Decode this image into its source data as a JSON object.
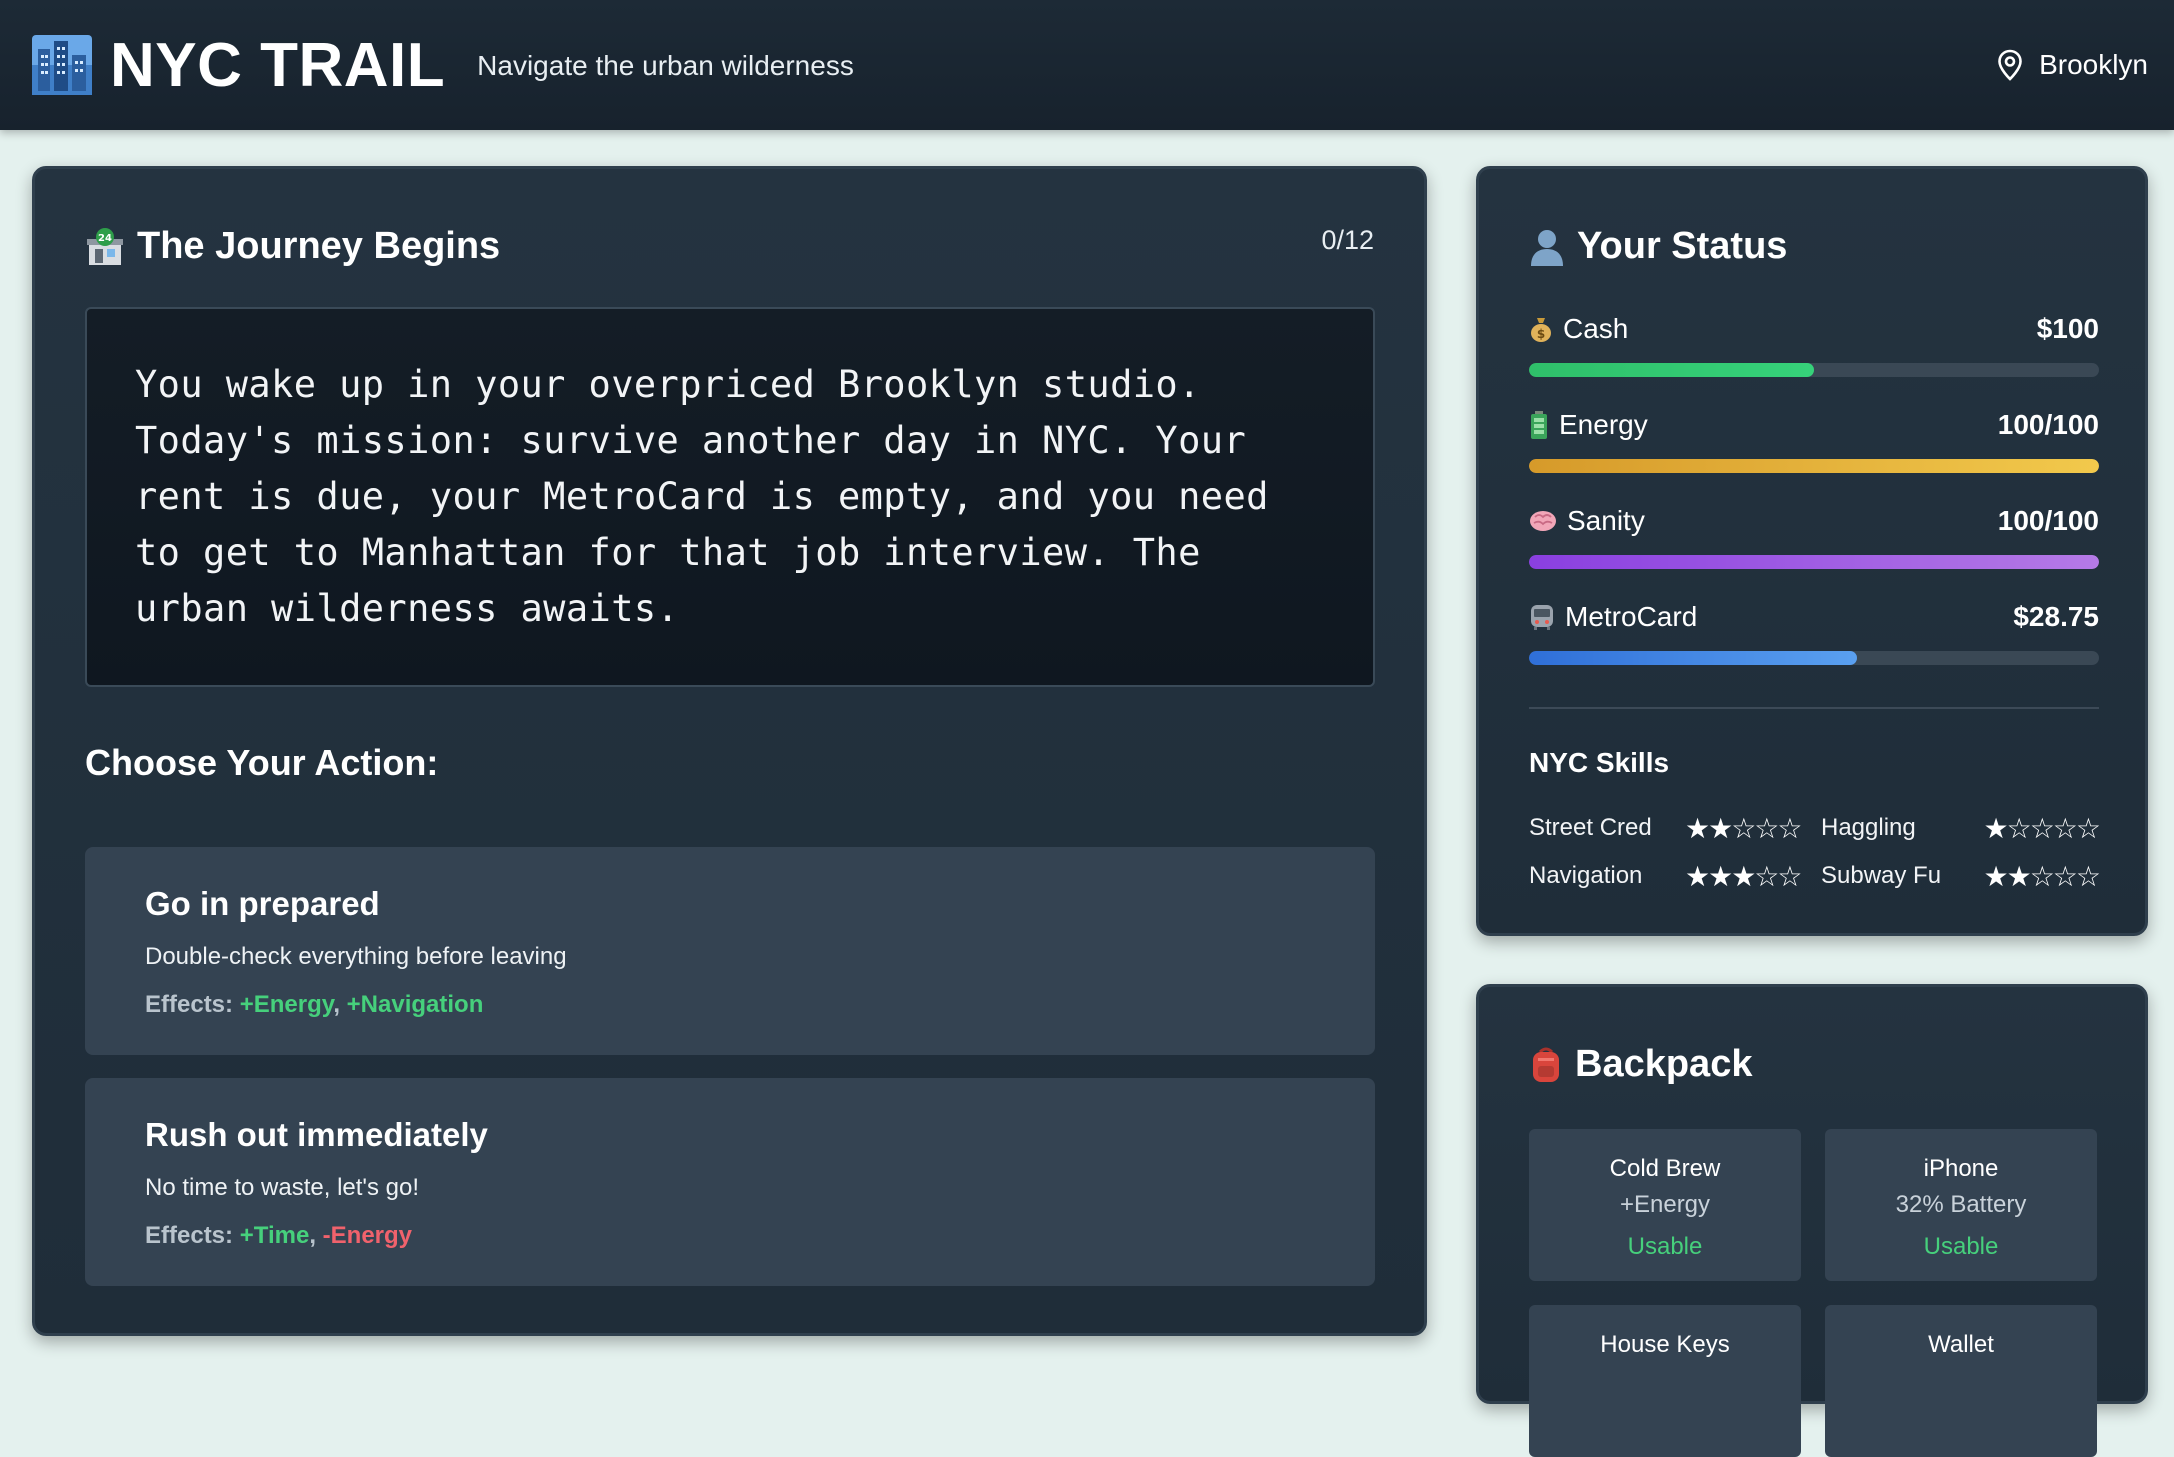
{
  "app": {
    "title": "NYC TRAIL",
    "tagline": "Navigate the urban wilderness",
    "location": "Brooklyn",
    "logo_icon": "cityscape-icon",
    "location_icon": "map-pin-icon"
  },
  "journey": {
    "title": "The Journey Begins",
    "icon": "atm-sign-icon",
    "progress": "0/12",
    "story": "You wake up in your overpriced Brooklyn studio. Today's mission: survive another day in NYC. Your rent is due, your MetroCard is empty, and you need to get to Manhattan for that job interview. The urban wilderness awaits.",
    "choose_label": "Choose Your Action:",
    "choices": [
      {
        "title": "Go in prepared",
        "description": "Double-check everything before leaving",
        "effects_label": "Effects:",
        "effects": [
          {
            "text": "+Energy",
            "type": "positive"
          },
          {
            "text": "+Navigation",
            "type": "positive"
          }
        ]
      },
      {
        "title": "Rush out immediately",
        "description": "No time to waste, let's go!",
        "effects_label": "Effects:",
        "effects": [
          {
            "text": "+Time",
            "type": "positive"
          },
          {
            "text": "-Energy",
            "type": "negative"
          }
        ]
      }
    ]
  },
  "status": {
    "title": "Your Status",
    "icon": "person-silhouette-icon",
    "stats": [
      {
        "name": "Cash",
        "icon": "money-bag-icon",
        "value": "$100",
        "fill": 0.5,
        "color_from": "#2fbf6a",
        "color_to": "#36d27a"
      },
      {
        "name": "Energy",
        "icon": "battery-icon",
        "value": "100/100",
        "fill": 1.0,
        "color_from": "#d69a2a",
        "color_to": "#f2c94c"
      },
      {
        "name": "Sanity",
        "icon": "brain-icon",
        "value": "100/100",
        "fill": 1.0,
        "color_from": "#8a3fe0",
        "color_to": "#b57ae6"
      },
      {
        "name": "MetroCard",
        "icon": "metro-train-icon",
        "value": "$28.75",
        "fill": 0.575,
        "color_from": "#2f6fd8",
        "color_to": "#5aa0f0"
      }
    ],
    "skills_title": "NYC Skills",
    "skills": [
      {
        "name": "Street Cred",
        "rating": 2
      },
      {
        "name": "Haggling",
        "rating": 1
      },
      {
        "name": "Navigation",
        "rating": 3
      },
      {
        "name": "Subway Fu",
        "rating": 2
      }
    ],
    "max_rating": 5
  },
  "backpack": {
    "title": "Backpack",
    "icon": "backpack-icon",
    "items": [
      {
        "name": "Cold Brew",
        "detail": "+Energy",
        "status": "Usable"
      },
      {
        "name": "iPhone",
        "detail": "32% Battery",
        "status": "Usable"
      },
      {
        "name": "House Keys",
        "detail": "",
        "status": ""
      },
      {
        "name": "Wallet",
        "detail": "",
        "status": ""
      }
    ]
  }
}
